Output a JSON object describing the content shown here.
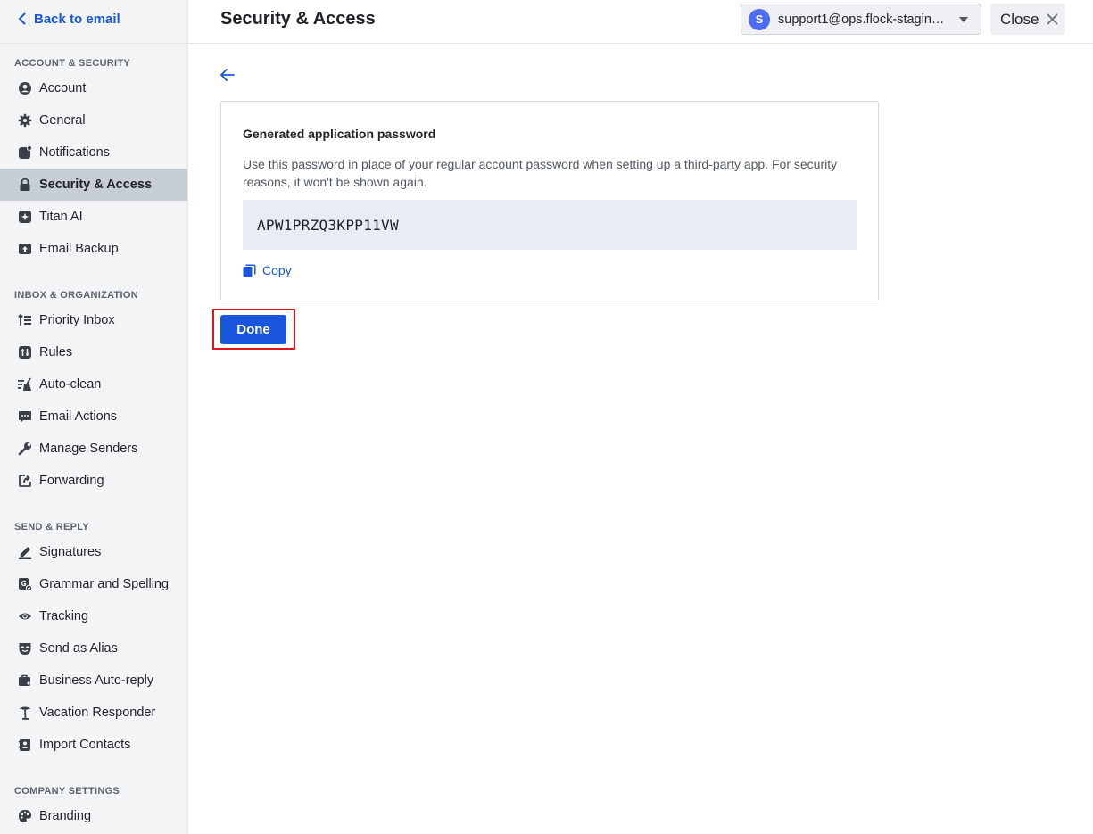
{
  "sidebar": {
    "back_label": "Back to email",
    "sections": {
      "account_security": "ACCOUNT & SECURITY",
      "inbox_organization": "INBOX & ORGANIZATION",
      "send_reply": "SEND & REPLY",
      "company_settings": "COMPANY SETTINGS"
    },
    "items": {
      "account": "Account",
      "general": "General",
      "notifications": "Notifications",
      "security_access": "Security & Access",
      "titan_ai": "Titan AI",
      "email_backup": "Email Backup",
      "priority_inbox": "Priority Inbox",
      "rules": "Rules",
      "auto_clean": "Auto-clean",
      "email_actions": "Email Actions",
      "manage_senders": "Manage Senders",
      "forwarding": "Forwarding",
      "signatures": "Signatures",
      "grammar_spelling": "Grammar and Spelling",
      "tracking": "Tracking",
      "send_as_alias": "Send as Alias",
      "business_auto_reply": "Business Auto-reply",
      "vacation_responder": "Vacation Responder",
      "import_contacts": "Import Contacts",
      "branding": "Branding"
    },
    "active_item": "security_access"
  },
  "header": {
    "title": "Security & Access",
    "account": {
      "avatar_letter": "S",
      "email": "support1@ops.flock-staging..."
    },
    "close_label": "Close"
  },
  "card": {
    "title": "Generated application password",
    "description": "Use this password in place of your regular account password when setting up a third-party app. For security reasons, it won't be shown again.",
    "password": "APW1PRZQ3KPP11VW",
    "copy_label": "Copy"
  },
  "done_label": "Done",
  "colors": {
    "accent": "#1a56db",
    "sidebar_bg": "#f3f4f6",
    "active_item_bg": "#c8ced8",
    "highlight": "#e0141b"
  }
}
